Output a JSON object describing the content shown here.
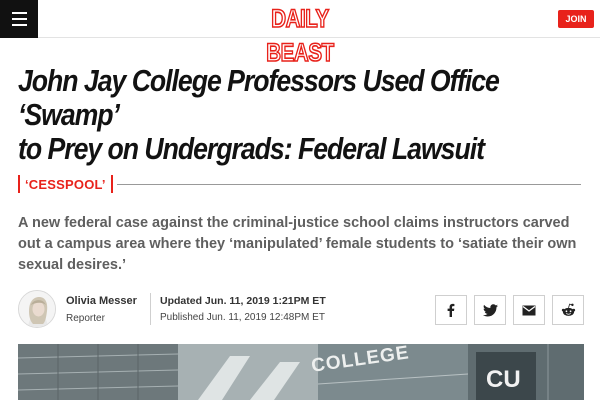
{
  "header": {
    "logo_text": "DAILY BEAST",
    "join_label": "JOIN",
    "brand_color": "#e8221b",
    "menu_icon": "hamburger-menu-icon"
  },
  "article": {
    "headline_line1": "John Jay College Professors Used Office ‘Swamp’",
    "headline_line2": "to Prey on Undergrads: Federal Lawsuit",
    "rubric": "‘CESSPOOL’",
    "dek": "A new federal case against the criminal-justice school claims instructors carved out a campus area where they ‘manipulated’ female students to ‘satiate their own sexual desires.’"
  },
  "byline": {
    "author_name": "Olivia Messer",
    "author_role": "Reporter",
    "updated": "Updated Jun. 11, 2019 1:21PM ET",
    "published": "Published Jun. 11, 2019 12:48PM ET"
  },
  "share": [
    {
      "icon": "facebook-icon"
    },
    {
      "icon": "twitter-icon"
    },
    {
      "icon": "email-icon"
    },
    {
      "icon": "reddit-icon"
    }
  ],
  "hero_image": {
    "sign_text_1": "COLLEGE",
    "sign_text_2": "CU"
  }
}
